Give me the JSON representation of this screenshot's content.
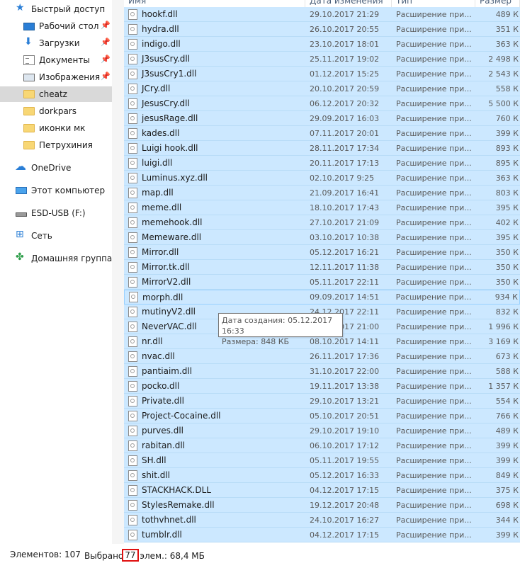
{
  "nav": {
    "items": [
      {
        "label": "Быстрый доступ",
        "icon": "star-icon",
        "pinned": false
      },
      {
        "label": "Рабочий стол",
        "icon": "desktop-icon",
        "pinned": true
      },
      {
        "label": "Загрузки",
        "icon": "downloads-icon",
        "pinned": true
      },
      {
        "label": "Документы",
        "icon": "documents-icon",
        "pinned": true
      },
      {
        "label": "Изображения",
        "icon": "pictures-icon",
        "pinned": true
      },
      {
        "label": "cheatz",
        "icon": "folder-icon",
        "pinned": false
      },
      {
        "label": "dorkpars",
        "icon": "folder-icon",
        "pinned": false
      },
      {
        "label": "иконки мк",
        "icon": "folder-icon",
        "pinned": false
      },
      {
        "label": "Петрухиния",
        "icon": "folder-icon",
        "pinned": false
      },
      {
        "label": "OneDrive",
        "icon": "onedrive-icon",
        "pinned": false
      },
      {
        "label": "Этот компьютер",
        "icon": "this-pc-icon",
        "pinned": false
      },
      {
        "label": "ESD-USB (F:)",
        "icon": "usb-drive-icon",
        "pinned": false
      },
      {
        "label": "Сеть",
        "icon": "network-icon",
        "pinned": false
      },
      {
        "label": "Домашняя группа",
        "icon": "homegroup-icon",
        "pinned": false
      }
    ]
  },
  "header": {
    "name": "Имя",
    "date": "Дата изменения",
    "type": "Тип",
    "size": "Размер"
  },
  "files": [
    {
      "name": "hookf.dll",
      "date": "29.10.2017 21:29",
      "type": "Расширение при...",
      "size": "489 К"
    },
    {
      "name": "hydra.dll",
      "date": "26.10.2017 20:55",
      "type": "Расширение при...",
      "size": "351 К"
    },
    {
      "name": "indigo.dll",
      "date": "23.10.2017 18:01",
      "type": "Расширение при...",
      "size": "363 К"
    },
    {
      "name": "J3susCry.dll",
      "date": "25.11.2017 19:02",
      "type": "Расширение при...",
      "size": "2 498 К"
    },
    {
      "name": "J3susCry1.dll",
      "date": "01.12.2017 15:25",
      "type": "Расширение при...",
      "size": "2 543 К"
    },
    {
      "name": "JCry.dll",
      "date": "20.10.2017 20:59",
      "type": "Расширение при...",
      "size": "558 К"
    },
    {
      "name": "JesusCry.dll",
      "date": "06.12.2017 20:32",
      "type": "Расширение при...",
      "size": "5 500 К"
    },
    {
      "name": "jesusRage.dll",
      "date": "29.09.2017 16:03",
      "type": "Расширение при...",
      "size": "760 К"
    },
    {
      "name": "kades.dll",
      "date": "07.11.2017 20:01",
      "type": "Расширение при...",
      "size": "399 К"
    },
    {
      "name": "Luigi hook.dll",
      "date": "28.11.2017 17:34",
      "type": "Расширение при...",
      "size": "893 К"
    },
    {
      "name": "luigi.dll",
      "date": "20.11.2017 17:13",
      "type": "Расширение при...",
      "size": "895 К"
    },
    {
      "name": "Luminus.xyz.dll",
      "date": "02.10.2017 9:25",
      "type": "Расширение при...",
      "size": "363 К"
    },
    {
      "name": "map.dll",
      "date": "21.09.2017 16:41",
      "type": "Расширение при...",
      "size": "803 К"
    },
    {
      "name": "meme.dll",
      "date": "18.10.2017 17:43",
      "type": "Расширение при...",
      "size": "395 К"
    },
    {
      "name": "memehook.dll",
      "date": "27.10.2017 21:09",
      "type": "Расширение при...",
      "size": "402 К"
    },
    {
      "name": "Memeware.dll",
      "date": "03.10.2017 10:38",
      "type": "Расширение при...",
      "size": "395 К"
    },
    {
      "name": "Mirror.dll",
      "date": "05.12.2017 16:21",
      "type": "Расширение при...",
      "size": "350 К"
    },
    {
      "name": "Mirror.tk.dll",
      "date": "12.11.2017 11:38",
      "type": "Расширение при...",
      "size": "350 К"
    },
    {
      "name": "MirrorV2.dll",
      "date": "05.11.2017 22:11",
      "type": "Расширение при...",
      "size": "350 К"
    },
    {
      "name": "morph.dll",
      "date": "09.09.2017 14:51",
      "type": "Расширение при...",
      "size": "934 К"
    },
    {
      "name": "mutinyV2.dll",
      "date": "24.12.2017 22:11",
      "type": "Расширение при...",
      "size": "832 К"
    },
    {
      "name": "NeverVAC.dll",
      "date": "11.12.2017 21:00",
      "type": "Расширение при...",
      "size": "1 996 К"
    },
    {
      "name": "nr.dll",
      "date": "08.10.2017 14:11",
      "type": "Расширение при...",
      "size": "3 169 К"
    },
    {
      "name": "nvac.dll",
      "date": "26.11.2017 17:36",
      "type": "Расширение при...",
      "size": "673 К"
    },
    {
      "name": "pantiaim.dll",
      "date": "31.10.2017 22:00",
      "type": "Расширение при...",
      "size": "588 К"
    },
    {
      "name": "pocko.dll",
      "date": "19.11.2017 13:38",
      "type": "Расширение при...",
      "size": "1 357 К"
    },
    {
      "name": "Private.dll",
      "date": "29.10.2017 13:21",
      "type": "Расширение при...",
      "size": "554 К"
    },
    {
      "name": "Project-Cocaine.dll",
      "date": "05.10.2017 20:51",
      "type": "Расширение при...",
      "size": "766 К"
    },
    {
      "name": "purves.dll",
      "date": "29.10.2017 19:10",
      "type": "Расширение при...",
      "size": "489 К"
    },
    {
      "name": "rabitan.dll",
      "date": "06.10.2017 17:12",
      "type": "Расширение при...",
      "size": "399 К"
    },
    {
      "name": "SH.dll",
      "date": "05.11.2017 19:55",
      "type": "Расширение при...",
      "size": "399 К"
    },
    {
      "name": "shit.dll",
      "date": "05.12.2017 16:33",
      "type": "Расширение при...",
      "size": "849 К"
    },
    {
      "name": "STACKHACK.DLL",
      "date": "04.12.2017 17:15",
      "type": "Расширение при...",
      "size": "375 К"
    },
    {
      "name": "StylesRemake.dll",
      "date": "19.12.2017 20:48",
      "type": "Расширение при...",
      "size": "698 К"
    },
    {
      "name": "tothvhnet.dll",
      "date": "24.10.2017 16:27",
      "type": "Расширение при...",
      "size": "344 К"
    },
    {
      "name": "tumblr.dll",
      "date": "04.12.2017 17:15",
      "type": "Расширение при...",
      "size": "399 К"
    }
  ],
  "tooltip": {
    "line1": "Дата создания: 05.12.2017 16:33",
    "line2": "Размера: 848 КБ"
  },
  "status": {
    "count": "Элементов: 107",
    "selected_prefix": "Выбрано",
    "selected_num": "77",
    "selected_suffix": "элем.: 68,4 МБ"
  },
  "colors": {
    "selection": "#cce8ff",
    "highlight_box": "#e01010",
    "accent": "#2a7ed6"
  }
}
